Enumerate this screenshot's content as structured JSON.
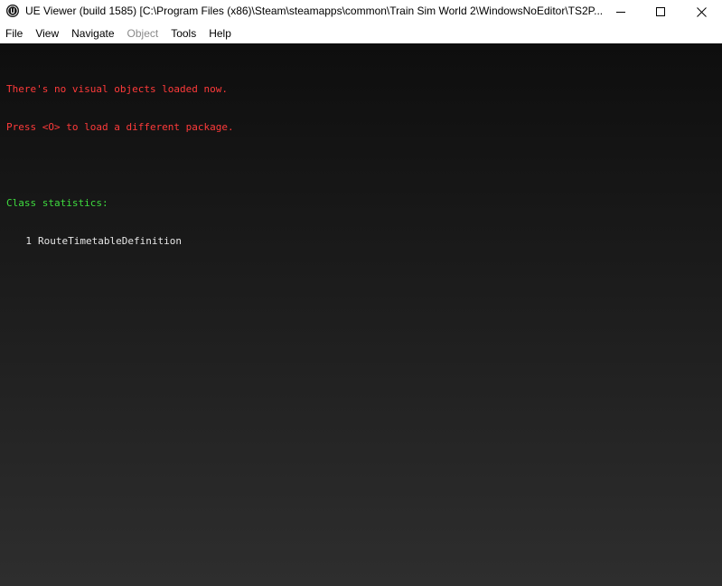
{
  "window": {
    "title": "UE Viewer (build 1585) [C:\\Program Files (x86)\\Steam\\steamapps\\common\\Train Sim World 2\\WindowsNoEditor\\TS2P..."
  },
  "menu": {
    "items": [
      {
        "label": "File",
        "enabled": true
      },
      {
        "label": "View",
        "enabled": true
      },
      {
        "label": "Navigate",
        "enabled": true
      },
      {
        "label": "Object",
        "enabled": false
      },
      {
        "label": "Tools",
        "enabled": true
      },
      {
        "label": "Help",
        "enabled": true
      }
    ]
  },
  "console": {
    "message_line1": "There's no visual objects loaded now.",
    "message_line2": "Press <O> to load a different package.",
    "stats_header": "Class statistics:",
    "stats": [
      {
        "count": "1",
        "class_name": "RouteTimetableDefinition"
      }
    ]
  },
  "colors": {
    "error_text": "#ff3a3a",
    "header_text": "#3fdc3f",
    "stat_text": "#e6e6e6",
    "viewport_top": "#0e0e0e",
    "viewport_bottom": "#2e2e2e"
  },
  "icons": {
    "app": "unreal-logo-icon",
    "minimize": "minimize-icon",
    "maximize": "maximize-icon",
    "close": "close-icon"
  }
}
